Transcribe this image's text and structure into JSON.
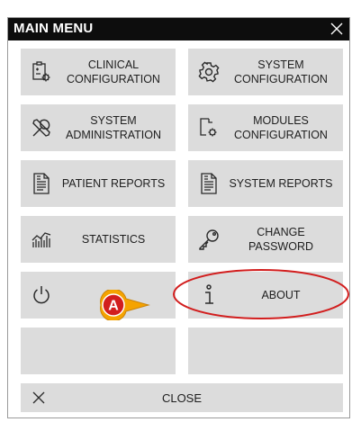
{
  "window": {
    "title": "MAIN MENU",
    "close_icon": "close-icon"
  },
  "tiles": [
    {
      "label": "CLINICAL\nCONFIGURATION",
      "icon": "clinical-config-icon"
    },
    {
      "label": "SYSTEM\nCONFIGURATION",
      "icon": "gear-icon"
    },
    {
      "label": "SYSTEM\nADMINISTRATION",
      "icon": "tools-icon"
    },
    {
      "label": "MODULES\nCONFIGURATION",
      "icon": "module-config-icon"
    },
    {
      "label": "PATIENT REPORTS",
      "icon": "document-icon"
    },
    {
      "label": "SYSTEM REPORTS",
      "icon": "document-icon"
    },
    {
      "label": "STATISTICS",
      "icon": "statistics-icon"
    },
    {
      "label": "CHANGE PASSWORD",
      "icon": "key-icon"
    },
    {
      "label": "QUIT",
      "visible_label": "QU",
      "icon": "power-icon"
    },
    {
      "label": "ABOUT",
      "icon": "info-icon"
    },
    {
      "label": ""
    },
    {
      "label": ""
    }
  ],
  "close_button": {
    "label": "CLOSE",
    "icon": "close-icon"
  },
  "annotation": {
    "marker_label": "A",
    "color": "#d21e1e",
    "marker_color": "#f5a300"
  }
}
